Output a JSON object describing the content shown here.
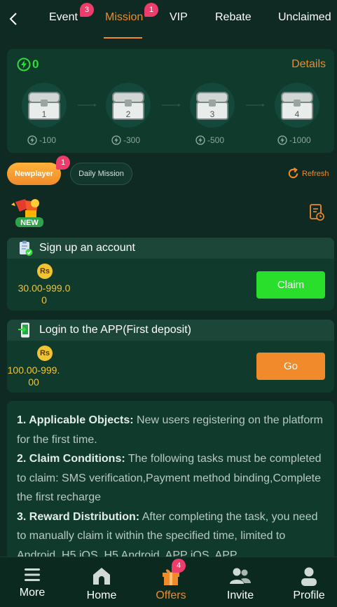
{
  "tabs": [
    {
      "label": "Event",
      "badge": "3"
    },
    {
      "label": "Mission",
      "badge": "1",
      "active": true
    },
    {
      "label": "VIP"
    },
    {
      "label": "Rebate"
    },
    {
      "label": "Unclaimed"
    }
  ],
  "progress": {
    "energy": "0",
    "details_label": "Details",
    "chests": [
      {
        "number": "1",
        "cost": "-100"
      },
      {
        "number": "2",
        "cost": "-300"
      },
      {
        "number": "3",
        "cost": "-500"
      },
      {
        "number": "4",
        "cost": "-1000"
      }
    ]
  },
  "subtabs": {
    "newplayer": "Newplayer",
    "newplayer_badge": "1",
    "daily": "Daily Mission",
    "refresh": "Refresh"
  },
  "new_logo_text": "NEW",
  "tasks": [
    {
      "title": "Sign up an account",
      "currency": "Rs",
      "amount_line1": "30.00-999.0",
      "amount_line2": "0",
      "button": "Claim"
    },
    {
      "title": "Login to the APP(First deposit)",
      "currency": "Rs",
      "amount_line1": "100.00-999.",
      "amount_line2": "00",
      "button": "Go"
    }
  ],
  "rules": [
    {
      "head": "1. Applicable Objects:",
      "text": " New users registering on the platform for the first time."
    },
    {
      "head": "2. Claim Conditions:",
      "text": " The following tasks must be completed to claim: SMS verification,Payment method binding,Complete the first recharge"
    },
    {
      "head": "3. Reward Distribution:",
      "text": " After completing the task, you need to manually claim it within the specified time, limited to Android, H5 iOS, H5 Android, APP iOS, APP"
    }
  ],
  "nav": [
    {
      "label": "More",
      "icon": "menu-icon"
    },
    {
      "label": "Home",
      "icon": "home-icon"
    },
    {
      "label": "Offers",
      "icon": "gift-icon",
      "badge": "4",
      "active": true
    },
    {
      "label": "Invite",
      "icon": "users-icon"
    },
    {
      "label": "Profile",
      "icon": "profile-icon"
    }
  ],
  "colors": {
    "accent": "#f08a2b",
    "energy": "#2fdc3a",
    "claim": "#2ade2c",
    "currency": "#f2c433",
    "badge": "#ee3d6a",
    "background": "#0e2a22"
  }
}
